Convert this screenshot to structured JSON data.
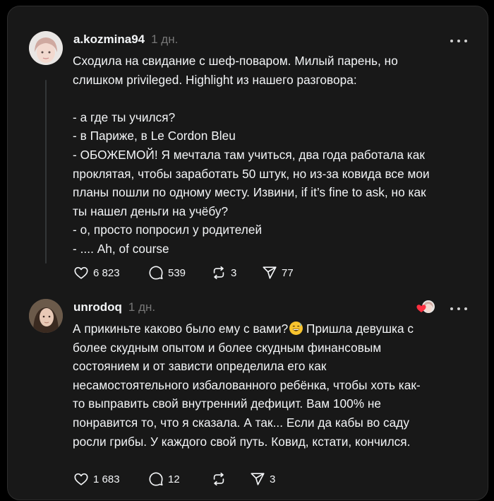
{
  "posts": [
    {
      "username": "a.kozmina94",
      "time": "1 дн.",
      "text": "Сходила на свидание с шеф-поваром. Милый парень, но\nслишком privileged. Highlight из нашего разговора:\n\n- а где ты учился?\n- в Париже, в Le Cordon Bleu\n- ОБОЖЕМОЙ! Я мечтала там учиться, два года работала как\nпроклятая, чтобы заработать 50 штук, но из-за ковида все мои\nпланы пошли по одному месту. Извини, if it’s fine to ask, но как\nты нашел деньги на учёбу?\n- о, просто попросил у родителей\n- .... Ah, of course",
      "likes": "6 823",
      "comments": "539",
      "reposts": "3",
      "shares": "77"
    },
    {
      "username": "unrodoq",
      "time": "1 дн.",
      "text_before_emoji": "А прикиньте каково было ему с вами?",
      "text_after_emoji": "  Пришла девушка с\nболее скудным опытом и более скудным финансовым\nсостоянием и от зависти определила его как\nнесамостоятельного избалованного ребёнка, чтобы хоть как-\nто выправить свой внутренний дефицит. Вам 100% не\nпонравится то, что я сказала. А так... Если да кабы во саду\nросли грибы. У каждого свой путь. Ковид, кстати, кончился.",
      "emoji_icon": "sweat-smile-emoji-icon",
      "likes": "1 683",
      "comments": "12",
      "shares": "3"
    }
  ],
  "colors": {
    "background": "#181818",
    "text": "#f3f5f7",
    "muted": "#777777",
    "liked_heart": "#ff3040"
  }
}
